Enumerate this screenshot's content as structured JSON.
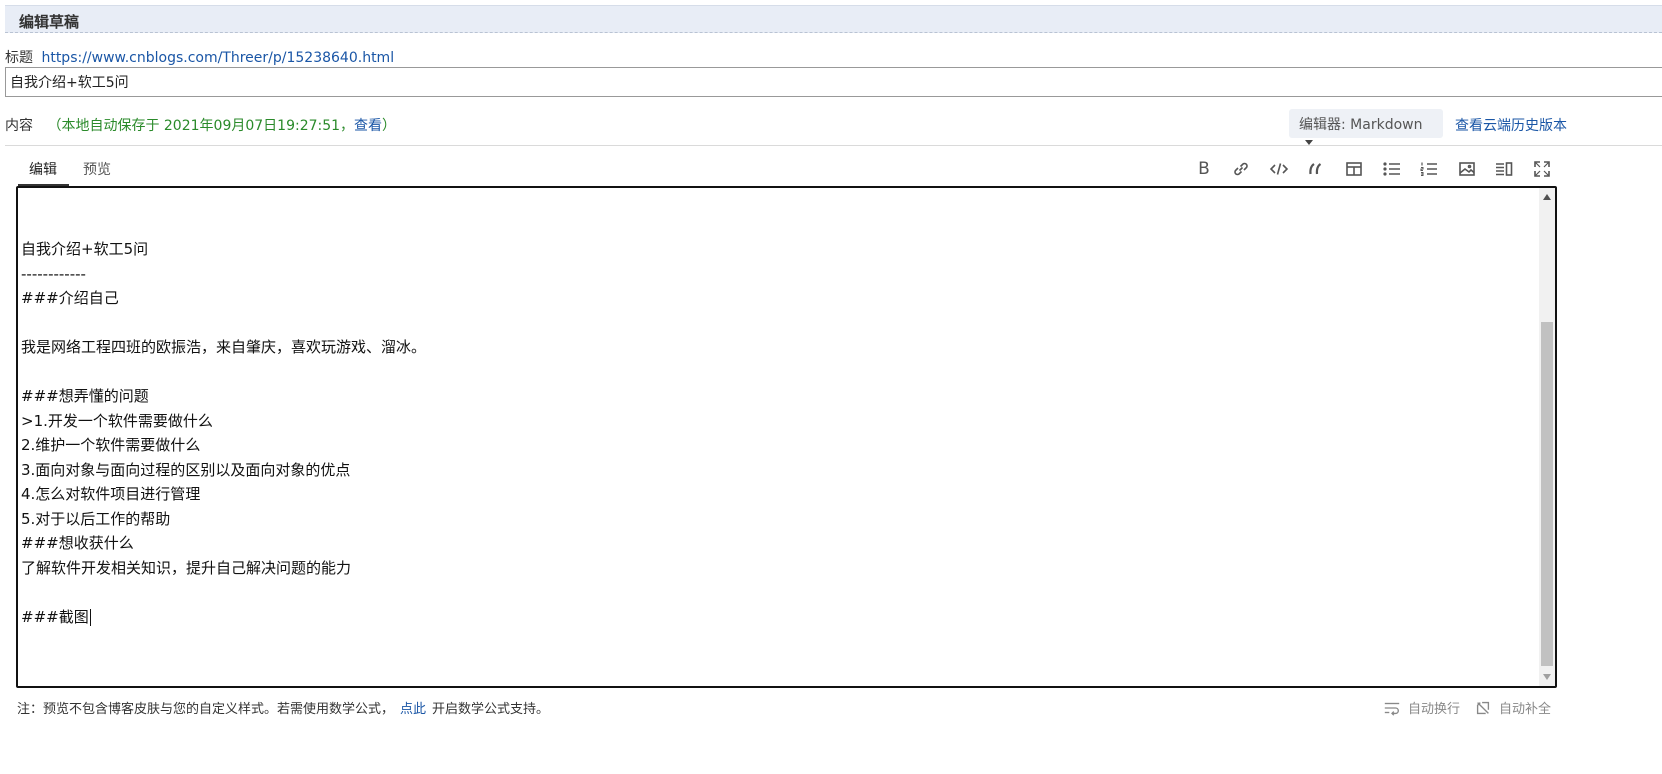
{
  "header": {
    "title": "编辑草稿"
  },
  "title_row": {
    "label": "标题",
    "link": "https://www.cnblogs.com/Threer/p/15238640.html",
    "input_value": "自我介绍+软工5问"
  },
  "content_row": {
    "label": "内容",
    "autosave_prefix": "（本地自动保存于 2021年09月07日19:27:51，",
    "autosave_link": "查看",
    "autosave_suffix": "）",
    "editor_select": "编辑器: Markdown",
    "cloud_history": "查看云端历史版本"
  },
  "tabs": [
    {
      "label": "编辑",
      "active": true
    },
    {
      "label": "预览",
      "active": false
    }
  ],
  "toolbar": [
    {
      "name": "bold-icon",
      "label": "B"
    },
    {
      "name": "link-icon"
    },
    {
      "name": "code-icon"
    },
    {
      "name": "quote-icon"
    },
    {
      "name": "table-icon"
    },
    {
      "name": "unordered-list-icon"
    },
    {
      "name": "ordered-list-icon"
    },
    {
      "name": "image-icon"
    },
    {
      "name": "side-by-side-icon"
    },
    {
      "name": "fullscreen-icon"
    }
  ],
  "editor": {
    "lines": [
      "",
      "",
      "自我介绍+软工5问",
      "------------",
      "###介绍自己",
      "",
      "我是网络工程四班的欧振浩，来自肇庆，喜欢玩游戏、溜冰。",
      "",
      "###想弄懂的问题",
      ">1.开发一个软件需要做什么",
      "2.维护一个软件需要做什么",
      "3.面向对象与面向过程的区别以及面向对象的优点",
      "4.怎么对软件项目进行管理",
      "5.对于以后工作的帮助",
      "###想收获什么",
      "了解软件开发相关知识，提升自己解决问题的能力",
      "",
      "###截图"
    ]
  },
  "footer": {
    "note_prefix": "注：预览不包含博客皮肤与您的自定义样式。若需使用数学公式，",
    "note_link": "点此",
    "note_suffix": "开启数学公式支持。",
    "auto_wrap": "自动换行",
    "auto_complete": "自动补全"
  }
}
